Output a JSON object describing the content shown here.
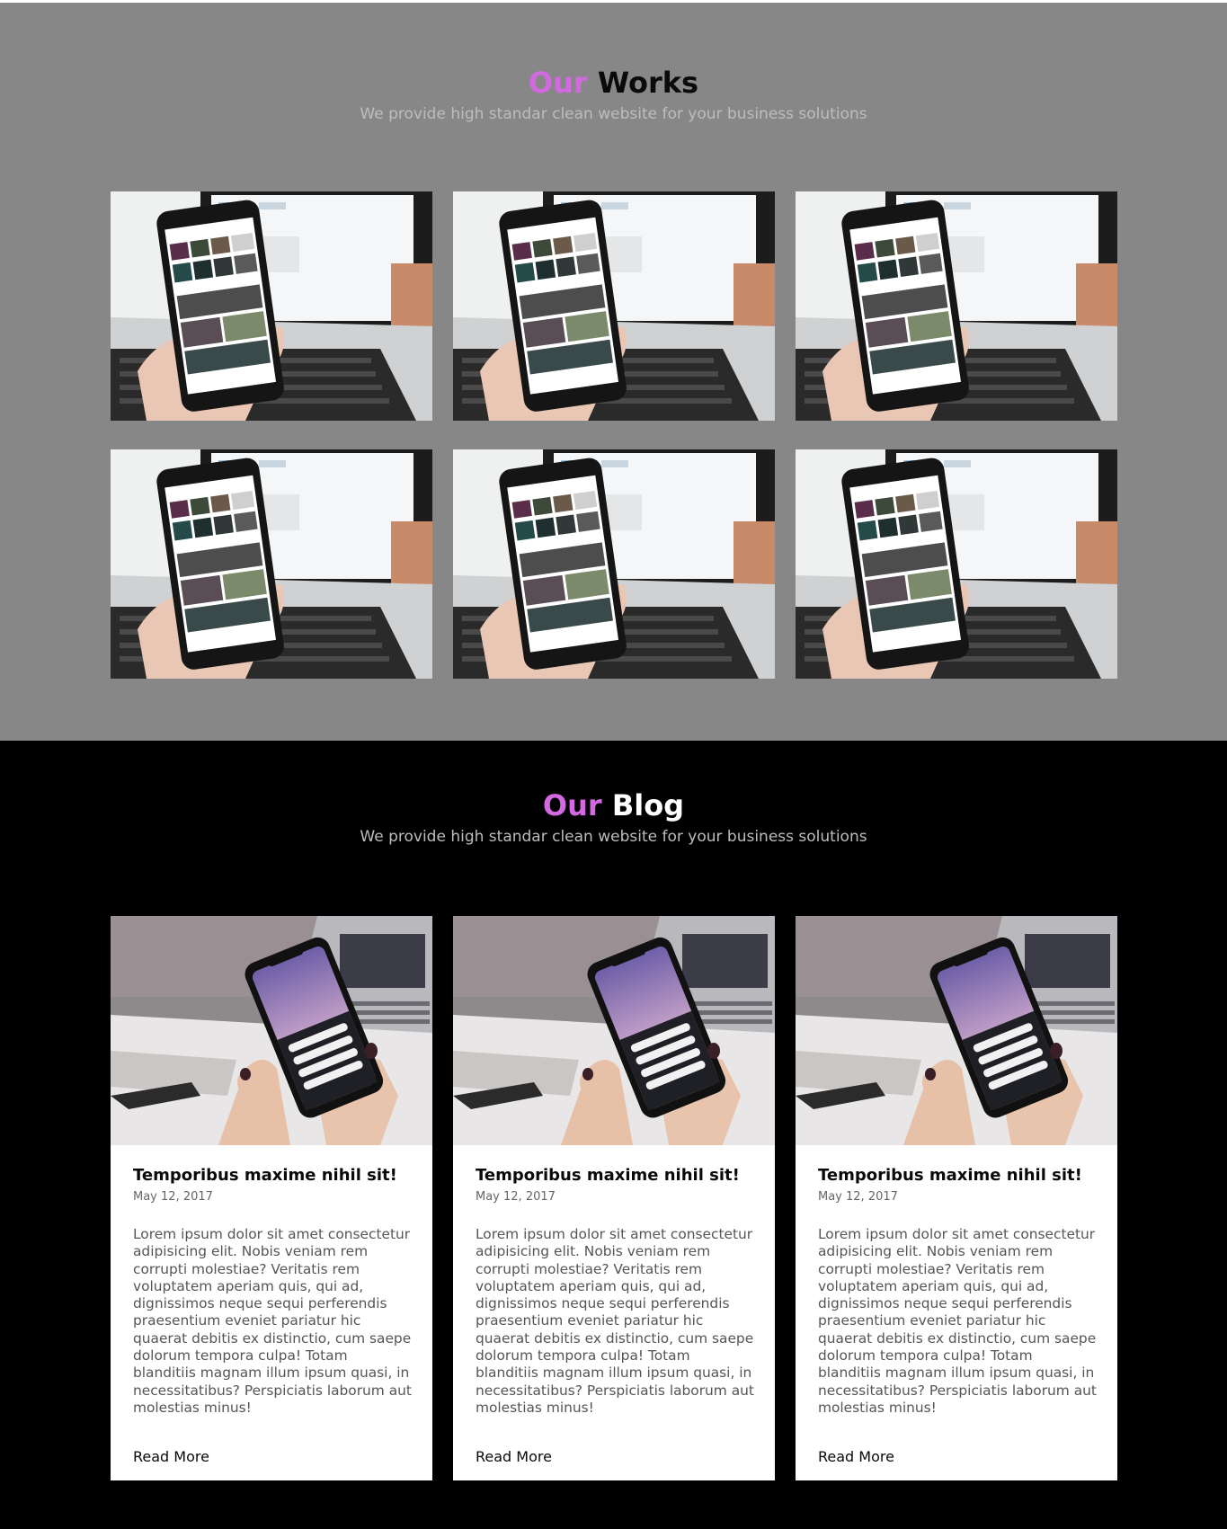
{
  "works": {
    "title_accent": "Our",
    "title_rest": "Works",
    "subtitle": "We provide high standar clean website for your business solutions",
    "images": [
      {
        "alt": "Phone showing photo gallery in front of laptop"
      },
      {
        "alt": "Phone showing photo gallery in front of laptop"
      },
      {
        "alt": "Phone showing photo gallery in front of laptop"
      },
      {
        "alt": "Phone showing photo gallery in front of laptop"
      },
      {
        "alt": "Phone showing photo gallery in front of laptop"
      },
      {
        "alt": "Phone showing photo gallery in front of laptop"
      }
    ]
  },
  "blog": {
    "title_accent": "Our",
    "title_rest": "Blog",
    "subtitle": "We provide high standar clean website for your business solutions",
    "posts": [
      {
        "title": "Temporibus maxime nihil sit!",
        "date": "May 12, 2017",
        "body": "Lorem ipsum dolor sit amet consectetur adipisicing elit. Nobis veniam rem corrupti molestiae? Veritatis rem voluptatem aperiam quis, qui ad, dignissimos neque sequi perferendis praesentium eveniet pariatur hic quaerat debitis ex distinctio, cum saepe dolorum tempora culpa! Totam blanditiis magnam illum ipsum quasi, in necessitatibus? Perspiciatis laborum aut molestias minus!",
        "link": "Read More"
      },
      {
        "title": "Temporibus maxime nihil sit!",
        "date": "May 12, 2017",
        "body": "Lorem ipsum dolor sit amet consectetur adipisicing elit. Nobis veniam rem corrupti molestiae? Veritatis rem voluptatem aperiam quis, qui ad, dignissimos neque sequi perferendis praesentium eveniet pariatur hic quaerat debitis ex distinctio, cum saepe dolorum tempora culpa! Totam blanditiis magnam illum ipsum quasi, in necessitatibus? Perspiciatis laborum aut molestias minus!",
        "link": "Read More"
      },
      {
        "title": "Temporibus maxime nihil sit!",
        "date": "May 12, 2017",
        "body": "Lorem ipsum dolor sit amet consectetur adipisicing elit. Nobis veniam rem corrupti molestiae? Veritatis rem voluptatem aperiam quis, qui ad, dignissimos neque sequi perferendis praesentium eveniet pariatur hic quaerat debitis ex distinctio, cum saepe dolorum tempora culpa! Totam blanditiis magnam illum ipsum quasi, in necessitatibus? Perspiciatis laborum aut molestias minus!",
        "link": "Read More"
      }
    ]
  },
  "colors": {
    "accent": "#d269e0",
    "works_bg": "#878787",
    "blog_bg": "#000000",
    "card_bg": "#ffffff"
  }
}
